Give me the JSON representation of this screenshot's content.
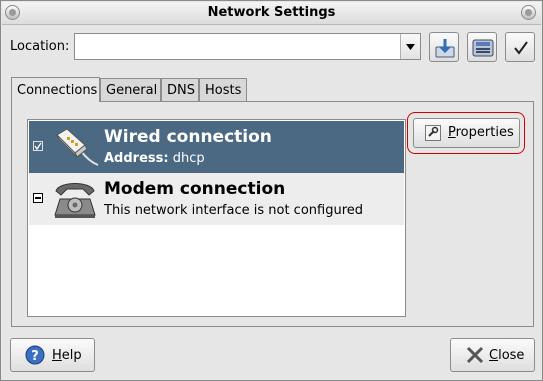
{
  "window": {
    "title": "Network Settings"
  },
  "location": {
    "label": "Location:",
    "value": ""
  },
  "tabs": [
    {
      "label": "Connections",
      "active": true
    },
    {
      "label": "General",
      "active": false
    },
    {
      "label": "DNS",
      "active": false
    },
    {
      "label": "Hosts",
      "active": false
    }
  ],
  "connections": [
    {
      "name": "Wired connection",
      "detail_label": "Address:",
      "detail_value": "dhcp",
      "enabled": true,
      "selected": true,
      "icon": "ethernet-plug-icon"
    },
    {
      "name": "Modem connection",
      "detail": "This network interface is not configured",
      "enabled": false,
      "selected": false,
      "icon": "telephone-icon"
    }
  ],
  "buttons": {
    "properties": {
      "prefix": "",
      "mnemonic": "P",
      "rest": "roperties"
    },
    "help": {
      "mnemonic": "H",
      "rest": "elp"
    },
    "close": {
      "mnemonic": "C",
      "rest": "lose"
    }
  },
  "toolbar": {
    "icons": [
      "import-icon",
      "save-location-icon",
      "apply-icon"
    ]
  },
  "colors": {
    "selection": "#4b6983",
    "highlight_outline": "#d40000"
  }
}
